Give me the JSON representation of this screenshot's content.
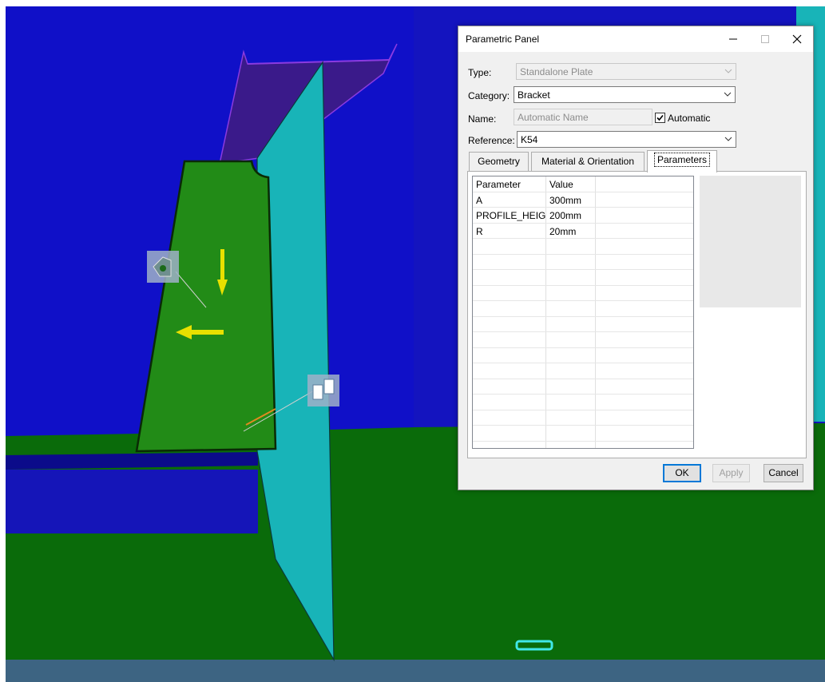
{
  "dialog": {
    "title": "Parametric Panel",
    "fields": {
      "type_label": "Type:",
      "type_value": "Standalone Plate",
      "category_label": "Category:",
      "category_value": "Bracket",
      "name_label": "Name:",
      "name_value": "Automatic Name",
      "automatic_label": "Automatic",
      "automatic_checked": true,
      "reference_label": "Reference:",
      "reference_value": "K54"
    },
    "tabs": [
      {
        "label": "Geometry",
        "active": false
      },
      {
        "label": "Material & Orientation",
        "active": false
      },
      {
        "label": "Parameters",
        "active": true
      }
    ],
    "table": {
      "columns": [
        "Parameter",
        "Value"
      ],
      "rows": [
        {
          "parameter": "A",
          "value": "300mm"
        },
        {
          "parameter": "PROFILE_HEIG...",
          "value": "200mm"
        },
        {
          "parameter": "R",
          "value": "20mm"
        }
      ]
    },
    "buttons": {
      "ok": "OK",
      "apply": "Apply",
      "cancel": "Cancel"
    }
  },
  "viewport": {
    "icons": [
      "bracket-handle-icon",
      "plate-handle-icon"
    ],
    "colors": {
      "background_blue": "#1010c8",
      "floor_green": "#0a6b0a",
      "bracket_green": "#228b17",
      "web_cyan": "#18b4b8",
      "flange_purple": "#3a1a8a",
      "arrow_yellow": "#e8e000",
      "bottom_steel": "#3d6482"
    }
  }
}
